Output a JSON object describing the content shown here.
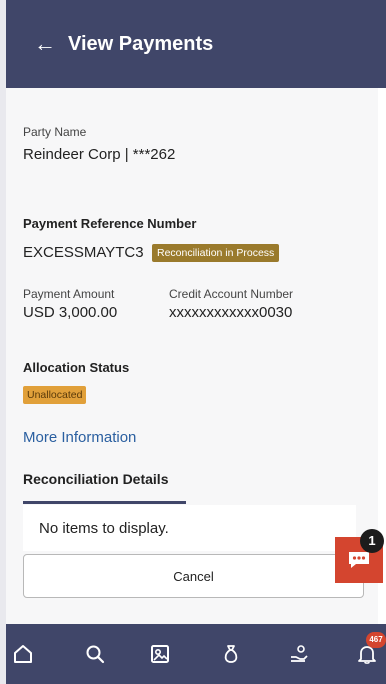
{
  "header": {
    "title": "View Payments"
  },
  "party": {
    "label": "Party Name",
    "value": "Reindeer Corp | ***262"
  },
  "payment_ref": {
    "label": "Payment Reference Number",
    "value": "EXCESSMAYTC3",
    "status_badge": "Reconciliation in Process"
  },
  "payment_amount": {
    "label": "Payment Amount",
    "value": "USD 3,000.00"
  },
  "credit_account": {
    "label": "Credit Account Number",
    "value": "xxxxxxxxxxxx0030"
  },
  "allocation": {
    "label": "Allocation Status",
    "badge": "Unallocated"
  },
  "more_info": "More Information",
  "reconciliation": {
    "title": "Reconciliation Details",
    "empty_text": "No items to display."
  },
  "actions": {
    "cancel_label": "Cancel"
  },
  "chat": {
    "badge_count": "1"
  },
  "bottom_nav": {
    "notification_count": "467"
  },
  "colors": {
    "header": "#404669",
    "badge_recon": "#9a7a2c",
    "badge_unalloc": "#e1a03a",
    "link": "#2a5fa0",
    "chat": "#d4452f"
  }
}
